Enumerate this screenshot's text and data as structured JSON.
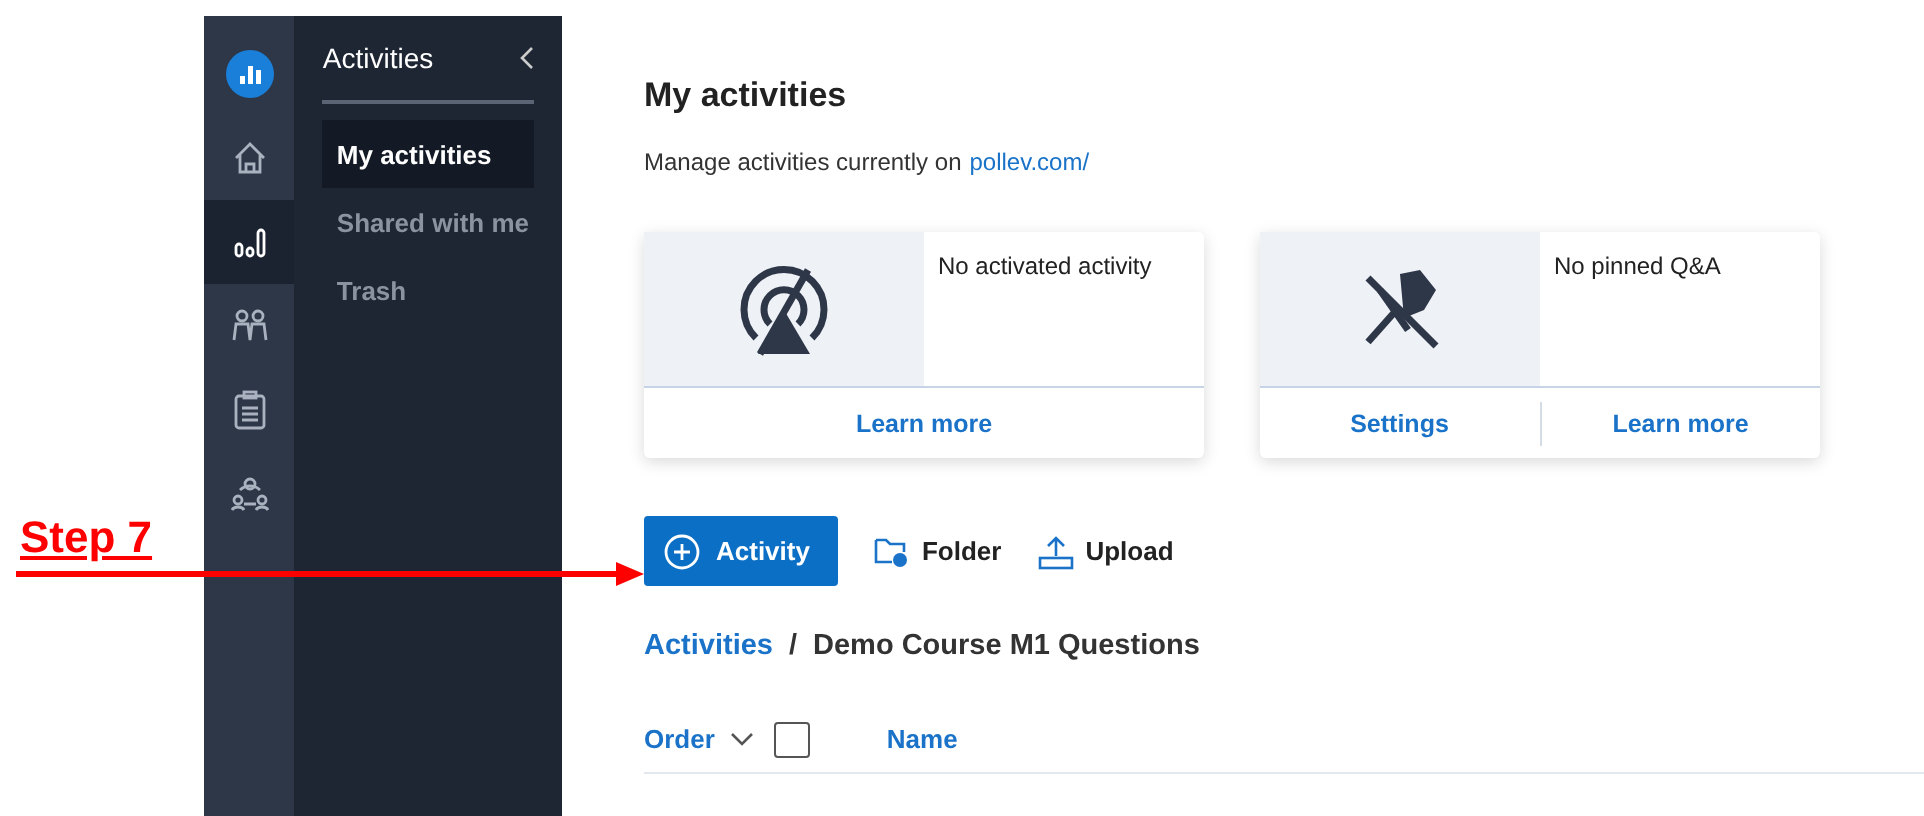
{
  "annotation": {
    "label": "Step 7"
  },
  "rail": {
    "items": [
      {
        "kind": "logo",
        "selected": false
      },
      {
        "kind": "home",
        "selected": false
      },
      {
        "kind": "chart",
        "selected": true
      },
      {
        "kind": "people",
        "selected": false
      },
      {
        "kind": "clipboard",
        "selected": false
      },
      {
        "kind": "group",
        "selected": false
      }
    ]
  },
  "sidebar": {
    "title": "Activities",
    "items": [
      {
        "label": "My activities",
        "selected": true
      },
      {
        "label": "Shared with me",
        "selected": false
      },
      {
        "label": "Trash",
        "selected": false
      }
    ]
  },
  "main": {
    "title": "My activities",
    "subtitle": "Manage activities currently on",
    "link": "pollev.com/",
    "cards": [
      {
        "kind": "activity",
        "message": "No activated activity",
        "actions": [
          "Learn more"
        ]
      },
      {
        "kind": "qa",
        "message": "No pinned Q&A",
        "actions": [
          "Settings",
          "Learn more"
        ]
      }
    ],
    "toolbar": [
      {
        "kind": "primary",
        "label": "Activity"
      },
      {
        "kind": "folder",
        "label": "Folder"
      },
      {
        "kind": "upload",
        "label": "Upload"
      }
    ],
    "breadcrumb": [
      {
        "label": "Activities",
        "link": true
      },
      {
        "label": "/",
        "link": false
      },
      {
        "label": "Demo Course M1 Questions",
        "link": false
      }
    ],
    "table": {
      "order": "Order",
      "checked": false,
      "name": "Name"
    }
  }
}
